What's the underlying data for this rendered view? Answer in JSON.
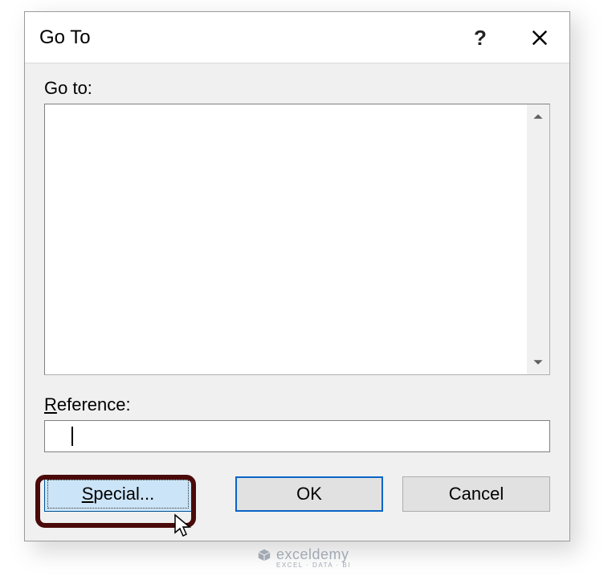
{
  "dialog": {
    "title": "Go To",
    "help_glyph": "?",
    "goto_label": "Go to:",
    "reference_label": "Reference:",
    "reference_value": "",
    "buttons": {
      "special": "Special...",
      "ok": "OK",
      "cancel": "Cancel"
    }
  },
  "watermark": {
    "name": "exceldemy",
    "tagline": "EXCEL · DATA · BI"
  }
}
